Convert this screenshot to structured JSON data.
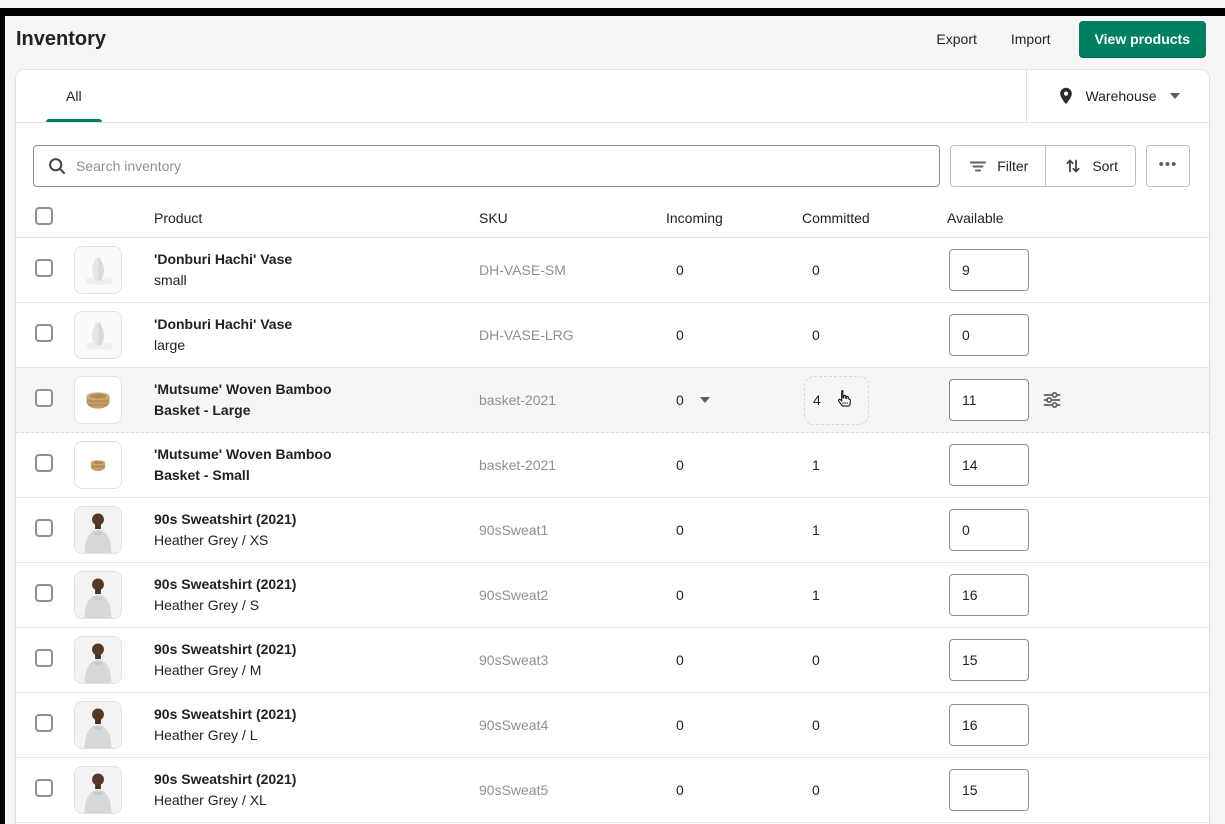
{
  "page": {
    "title": "Inventory"
  },
  "actions": {
    "export": "Export",
    "import": "Import",
    "view_products": "View products"
  },
  "tabs": {
    "all": "All"
  },
  "location_picker": {
    "label": "Warehouse"
  },
  "toolbar": {
    "search_placeholder": "Search inventory",
    "filter": "Filter",
    "sort": "Sort",
    "more": "•••"
  },
  "table": {
    "headers": {
      "product": "Product",
      "sku": "SKU",
      "incoming": "Incoming",
      "committed": "Committed",
      "available": "Available"
    },
    "rows": [
      {
        "title": "'Donburi Hachi' Vase",
        "variant": "small",
        "sku": "DH-VASE-SM",
        "incoming": "0",
        "committed": "0",
        "available": "9",
        "thumb": "vase"
      },
      {
        "title": "'Donburi Hachi' Vase",
        "variant": "large",
        "sku": "DH-VASE-LRG",
        "incoming": "0",
        "committed": "0",
        "available": "0",
        "thumb": "vase"
      },
      {
        "title": "'Mutsume' Woven Bamboo Basket - Large",
        "sku": "basket-2021",
        "incoming": "0",
        "committed": "4",
        "available": "11",
        "thumb": "basket-large",
        "highlighted": true,
        "incoming_caret": true,
        "committed_hover": true,
        "adjust_icon": true,
        "cursor": true
      },
      {
        "title": "'Mutsume' Woven Bamboo Basket - Small",
        "sku": "basket-2021",
        "incoming": "0",
        "committed": "1",
        "available": "14",
        "thumb": "basket-small"
      },
      {
        "title": "90s Sweatshirt (2021)",
        "variant": "Heather Grey / XS",
        "sku": "90sSweat1",
        "incoming": "0",
        "committed": "1",
        "available": "0",
        "thumb": "sweatshirt"
      },
      {
        "title": "90s Sweatshirt (2021)",
        "variant": "Heather Grey / S",
        "sku": "90sSweat2",
        "incoming": "0",
        "committed": "1",
        "available": "16",
        "thumb": "sweatshirt"
      },
      {
        "title": "90s Sweatshirt (2021)",
        "variant": "Heather Grey / M",
        "sku": "90sSweat3",
        "incoming": "0",
        "committed": "0",
        "available": "15",
        "thumb": "sweatshirt"
      },
      {
        "title": "90s Sweatshirt (2021)",
        "variant": "Heather Grey / L",
        "sku": "90sSweat4",
        "incoming": "0",
        "committed": "0",
        "available": "16",
        "thumb": "sweatshirt"
      },
      {
        "title": "90s Sweatshirt (2021)",
        "variant": "Heather Grey / XL",
        "sku": "90sSweat5",
        "incoming": "0",
        "committed": "0",
        "available": "15",
        "thumb": "sweatshirt"
      }
    ]
  },
  "colors": {
    "accent_green": "#008060",
    "page_bg": "#f6f6f7",
    "card_bg": "#ffffff",
    "border": "#e1e3e5",
    "text": "#202223",
    "subdued_text": "#8c9196"
  }
}
